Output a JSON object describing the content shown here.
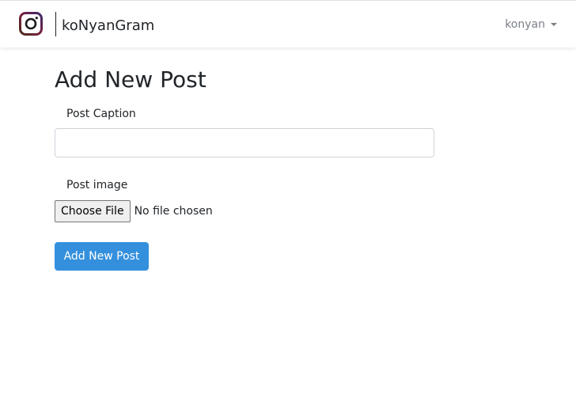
{
  "navbar": {
    "brand": "koNyanGram",
    "user_name": "konyan"
  },
  "form": {
    "title": "Add New Post",
    "caption_label": "Post Caption",
    "caption_value": "",
    "image_label": "Post image",
    "choose_file_label": "Choose File",
    "file_status": "No file chosen",
    "submit_label": "Add New Post"
  },
  "colors": {
    "accent": "#3490dc",
    "text": "#212529",
    "muted": "#7b8087"
  },
  "icons": {
    "logo": "instagram-camera-icon",
    "dropdown": "caret-down-icon"
  }
}
